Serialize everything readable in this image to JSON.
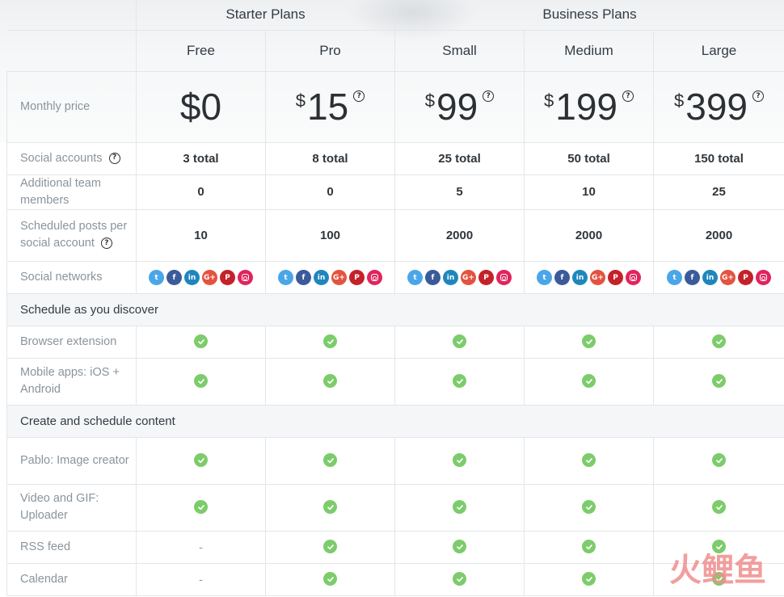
{
  "groups": {
    "starter": "Starter Plans",
    "business": "Business Plans"
  },
  "plans": [
    "Free",
    "Pro",
    "Small",
    "Medium",
    "Large"
  ],
  "price_row": {
    "label": "Monthly price",
    "currency": "$",
    "amounts": [
      "0",
      "15",
      "99",
      "199",
      "399"
    ],
    "help_icon": "question-circle-icon"
  },
  "rows": {
    "social_accounts": {
      "label": "Social accounts",
      "values": [
        "3 total",
        "8 total",
        "25 total",
        "50 total",
        "150 total"
      ]
    },
    "team_members": {
      "label": "Additional team members",
      "values": [
        "0",
        "0",
        "5",
        "10",
        "25"
      ]
    },
    "scheduled_posts": {
      "label": "Scheduled posts per social account",
      "values": [
        "10",
        "100",
        "2000",
        "2000",
        "2000"
      ]
    },
    "social_networks": {
      "label": "Social networks",
      "icons": [
        "twitter-icon",
        "facebook-icon",
        "linkedin-icon",
        "google-plus-icon",
        "pinterest-icon",
        "instagram-icon"
      ]
    }
  },
  "sections": {
    "discover": {
      "title": "Schedule as you discover",
      "rows": [
        {
          "label": "Browser extension",
          "values": [
            "check",
            "check",
            "check",
            "check",
            "check"
          ]
        },
        {
          "label": "Mobile apps: iOS + Android",
          "values": [
            "check",
            "check",
            "check",
            "check",
            "check"
          ]
        }
      ]
    },
    "content": {
      "title": "Create and schedule content",
      "rows": [
        {
          "label": "Pablo: Image creator",
          "values": [
            "check",
            "check",
            "check",
            "check",
            "check"
          ]
        },
        {
          "label": "Video and GIF: Uploader",
          "values": [
            "check",
            "check",
            "check",
            "check",
            "check"
          ]
        },
        {
          "label": "RSS feed",
          "values": [
            "-",
            "check",
            "check",
            "check",
            "check"
          ]
        },
        {
          "label": "Calendar",
          "values": [
            "-",
            "check",
            "check",
            "check",
            "check"
          ]
        }
      ]
    }
  },
  "dash": "-",
  "watermark": {
    "text": "火鲤鱼",
    "colors": [
      "#f08e8e",
      "#f4a6a6",
      "#9cc9f0"
    ]
  },
  "colors": {
    "check": "#7ccc6b",
    "twitter": "#4aa6e8",
    "facebook": "#3b5a9a",
    "linkedin": "#1f86bd",
    "google_plus": "#e3533f",
    "pinterest": "#c4212a",
    "instagram": "#e0245e"
  }
}
